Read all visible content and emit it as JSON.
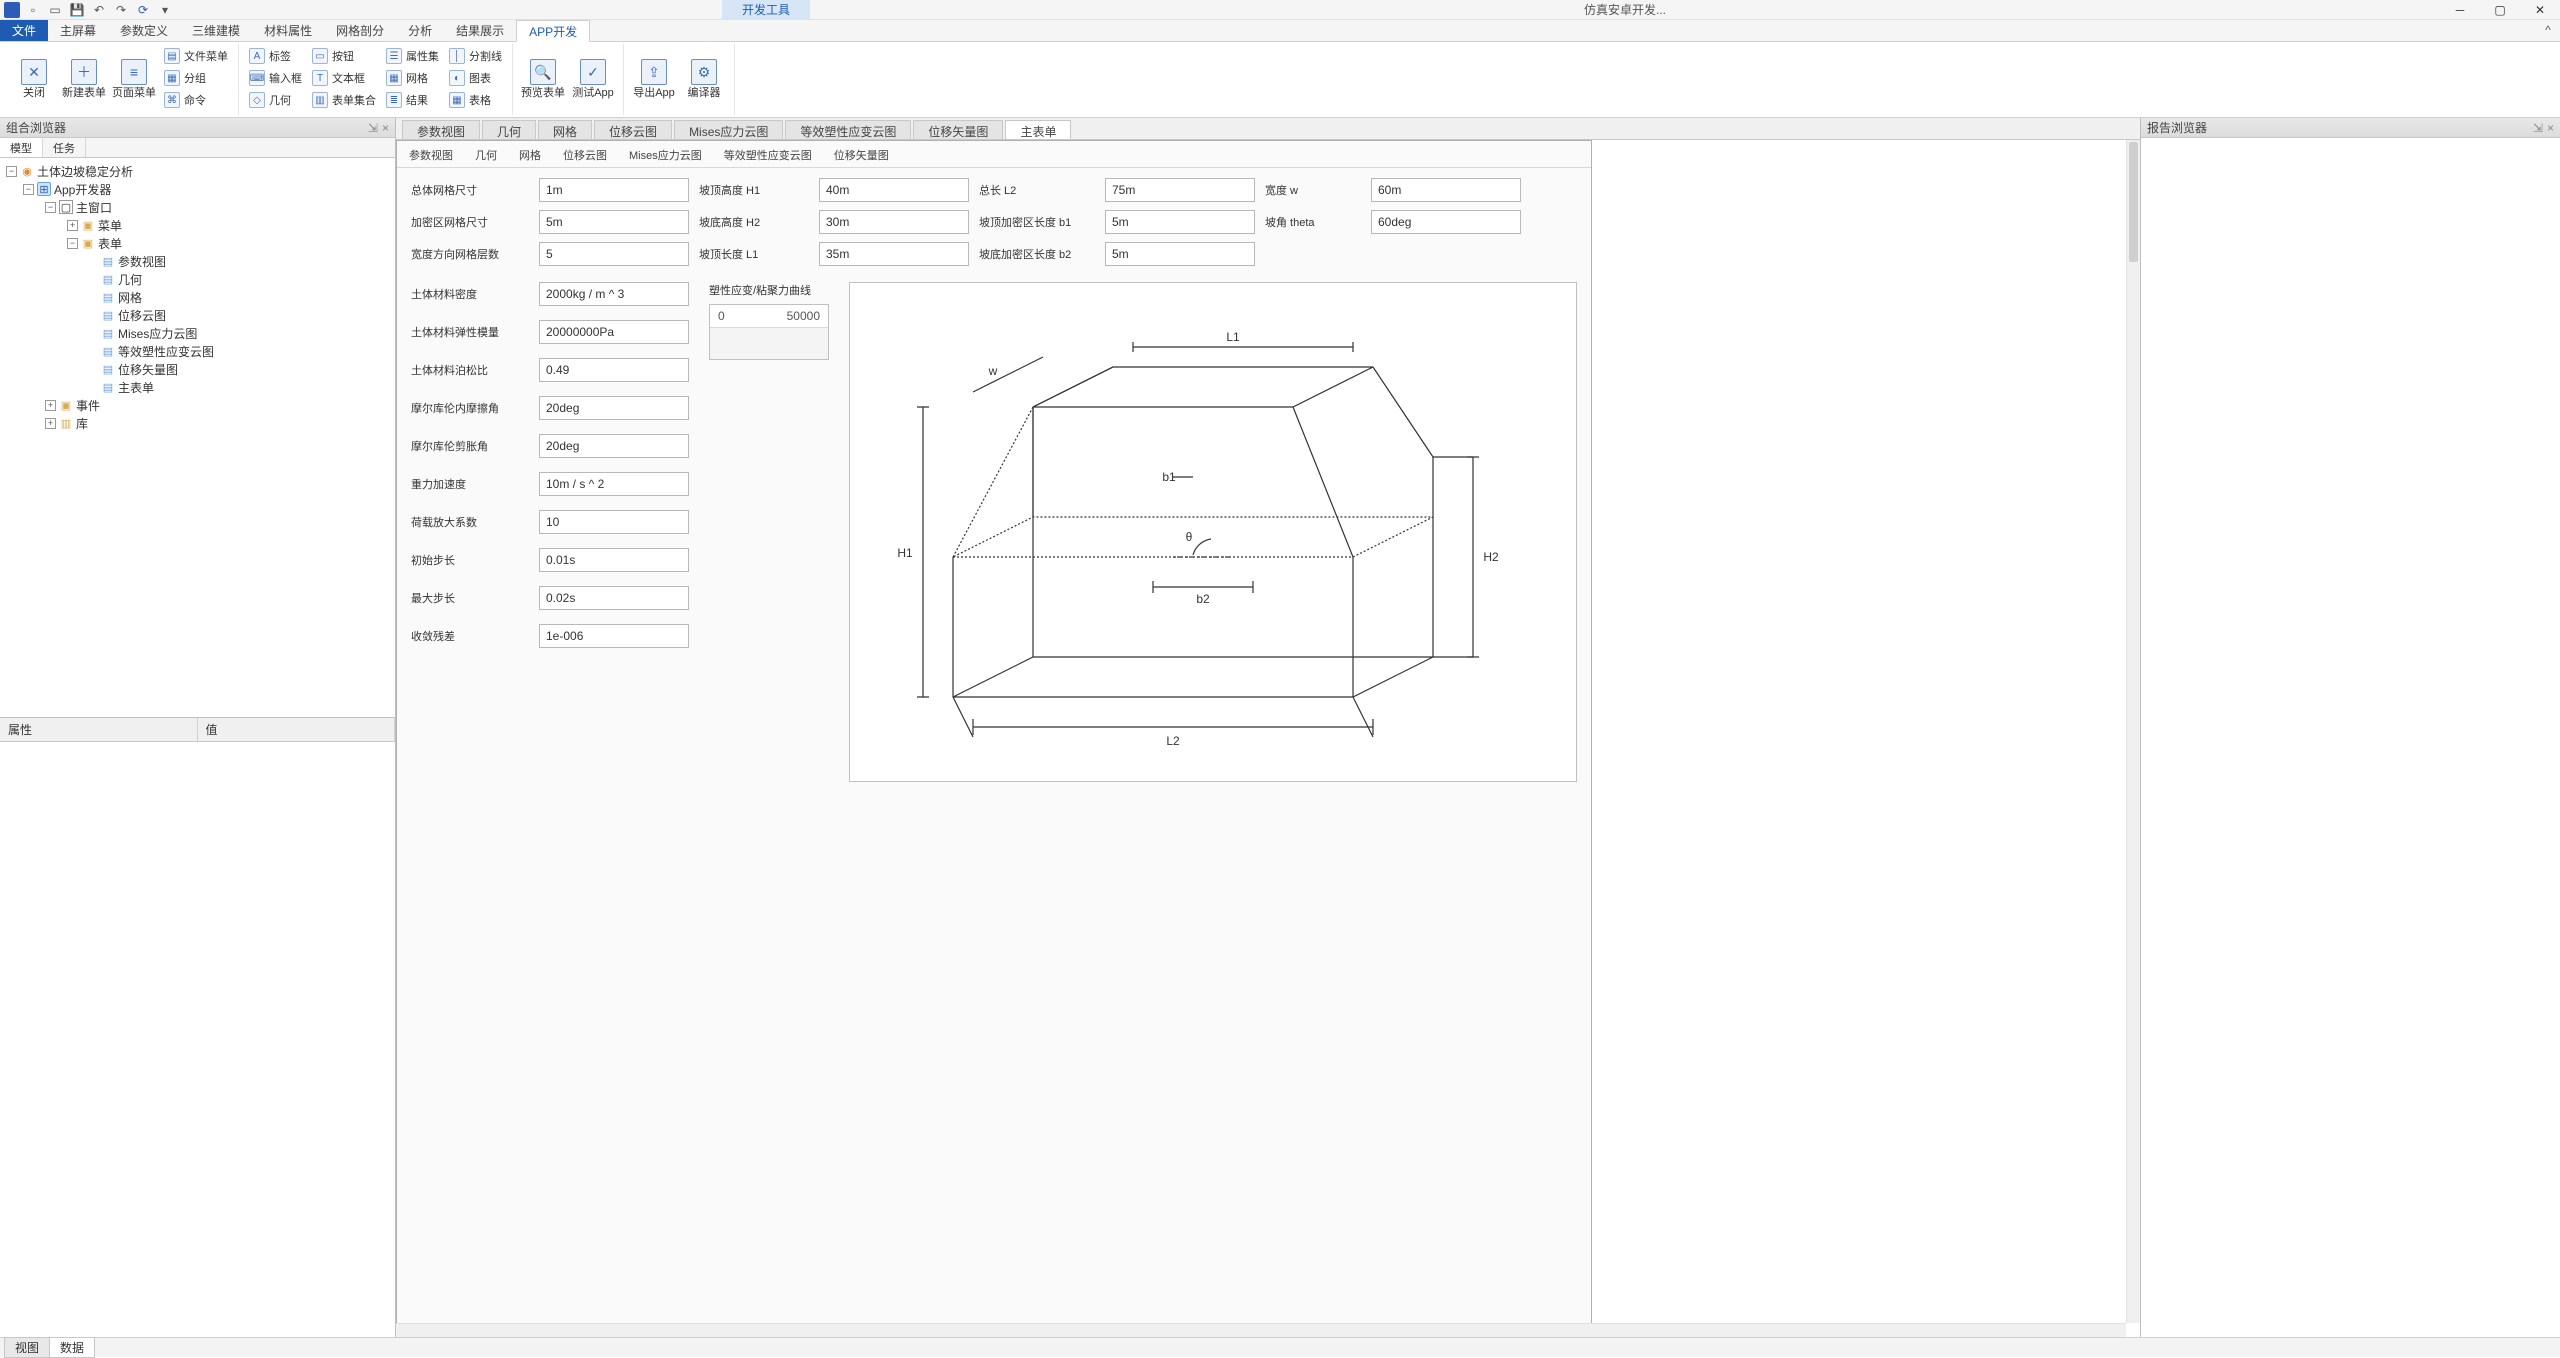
{
  "titlebar": {
    "app_title": "仿真安卓开发...",
    "context_tool": "开发工具"
  },
  "ribbon_tabs": {
    "file": "文件",
    "items": [
      "主屏幕",
      "参数定义",
      "三维建模",
      "材料属性",
      "网格剖分",
      "分析",
      "结果展示",
      "APP开发"
    ]
  },
  "ribbon": {
    "close": "关闭",
    "new_form": "新建表单",
    "page_menu": "页面菜单",
    "file_menu": "文件菜单",
    "group": "分组",
    "command": "命令",
    "label": "标签",
    "input_box": "输入框",
    "geometry": "几何",
    "button": "按钮",
    "text_box": "文本框",
    "form_set": "表单集合",
    "prop_set": "属性集",
    "mesh": "网格",
    "result": "结果",
    "split_line": "分割线",
    "chart": "图表",
    "table": "表格",
    "preview_form": "预览表单",
    "test_app": "测试App",
    "export_app": "导出App",
    "compiler": "编译器"
  },
  "left_panel": {
    "title": "组合浏览器",
    "tabs": {
      "model": "模型",
      "task": "任务"
    },
    "tree": {
      "root": "土体边坡稳定分析",
      "app": "App开发器",
      "main_window": "主窗口",
      "menu": "菜单",
      "forms": "表单",
      "form_items": [
        "参数视图",
        "几何",
        "网格",
        "位移云图",
        "Mises应力云图",
        "等效塑性应变云图",
        "位移矢量图",
        "主表单"
      ],
      "events": "事件",
      "library": "库"
    },
    "props": {
      "attr": "属性",
      "value": "值"
    }
  },
  "doc_tabs": [
    "参数视图",
    "几何",
    "网格",
    "位移云图",
    "Mises应力云图",
    "等效塑性应变云图",
    "位移矢量图",
    "主表单"
  ],
  "sub_tabs": [
    "参数视图",
    "几何",
    "网格",
    "位移云图",
    "Mises应力云图",
    "等效塑性应变云图",
    "位移矢量图"
  ],
  "form": {
    "row1": {
      "l1": "总体网格尺寸",
      "v1": "1m",
      "l2": "坡顶高度 H1",
      "v2": "40m",
      "l3": "总长 L2",
      "v3": "75m",
      "l4": "宽度 w",
      "v4": "60m"
    },
    "row2": {
      "l1": "加密区网格尺寸",
      "v1": "5m",
      "l2": "坡底高度 H2",
      "v2": "30m",
      "l3": "坡顶加密区长度 b1",
      "v3": "5m",
      "l4": "坡角 theta",
      "v4": "60deg"
    },
    "row3": {
      "l1": "宽度方向网格层数",
      "v1": "5",
      "l2": "坡顶长度 L1",
      "v2": "35m",
      "l3": "坡底加密区长度 b2",
      "v3": "5m"
    },
    "left": {
      "density_l": "土体材料密度",
      "density_v": "2000kg / m ^ 3",
      "young_l": "土体材料弹性模量",
      "young_v": "20000000Pa",
      "poisson_l": "土体材料泊松比",
      "poisson_v": "0.49",
      "friction_l": "摩尔库伦内摩擦角",
      "friction_v": "20deg",
      "dilat_l": "摩尔库伦剪胀角",
      "dilat_v": "20deg",
      "gravity_l": "重力加速度",
      "gravity_v": "10m / s ^ 2",
      "loadf_l": "荷载放大系数",
      "loadf_v": "10",
      "initstep_l": "初始步长",
      "initstep_v": "0.01s",
      "maxstep_l": "最大步长",
      "maxstep_v": "0.02s",
      "tol_l": "收敛残差",
      "tol_v": "1e-006"
    },
    "curve": {
      "label": "塑性应变/粘聚力曲线",
      "min": "0",
      "max": "50000"
    },
    "diagram_labels": {
      "L1": "L1",
      "L2": "L2",
      "H1": "H1",
      "H2": "H2",
      "w": "w",
      "b1": "b1",
      "b2": "b2",
      "theta": "θ"
    }
  },
  "right_panel": {
    "title": "报告浏览器"
  },
  "statusbar": {
    "view": "视图",
    "data": "数据"
  }
}
